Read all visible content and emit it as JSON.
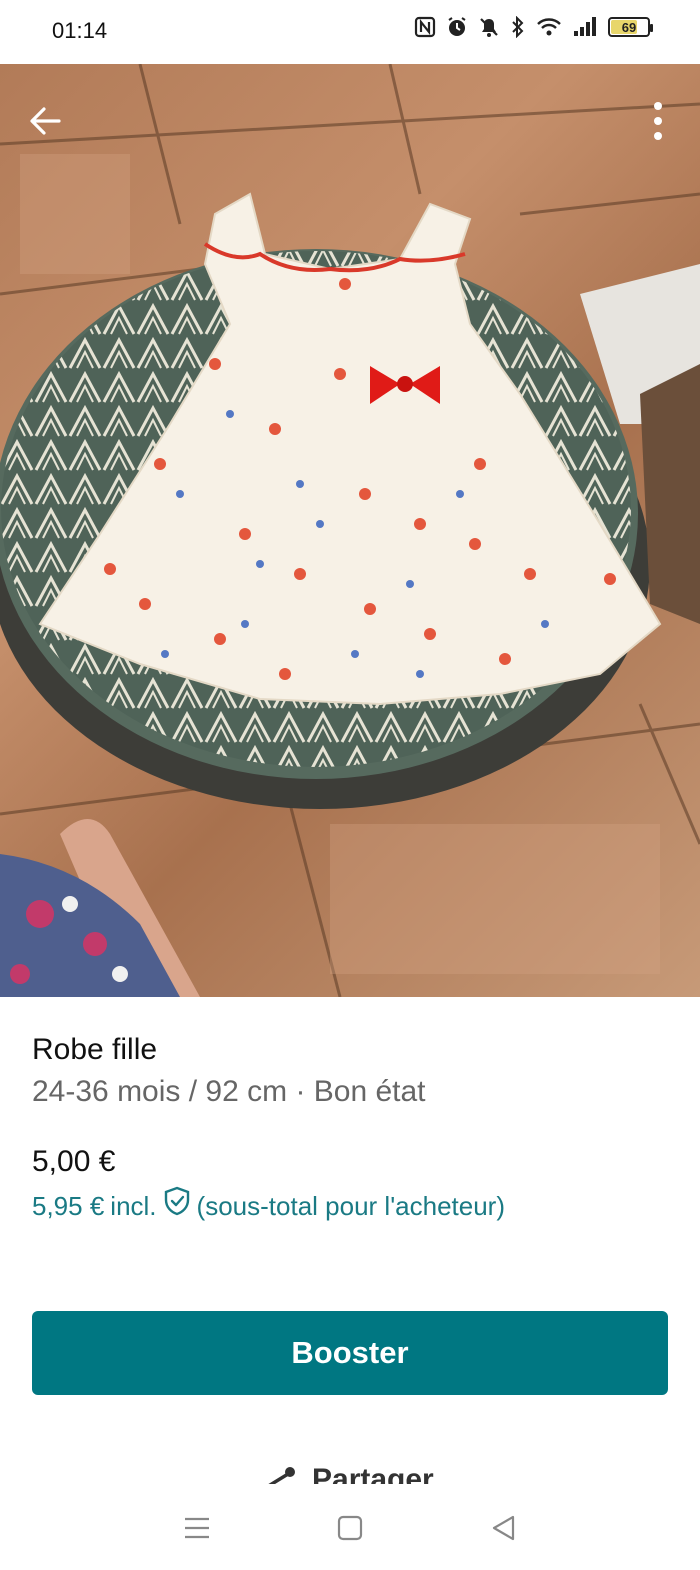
{
  "status_bar": {
    "time": "01:14",
    "battery_level": "69",
    "icons": [
      "nfc-icon",
      "alarm-icon",
      "mute-icon",
      "bluetooth-icon",
      "wifi-icon",
      "signal-icon",
      "battery-icon"
    ]
  },
  "photo": {
    "description_icon": "product-photo"
  },
  "item": {
    "title": "Robe fille",
    "subtitle": "24-36 mois / 92 cm · Bon état",
    "price": "5,00 €",
    "price_incl_amount": "5,95 €",
    "price_incl_label": "incl.",
    "price_incl_note": "(sous-total pour l'acheteur)"
  },
  "actions": {
    "booster_label": "Booster",
    "share_label": "Partager"
  },
  "colors": {
    "accent": "#007782",
    "accent_text": "#1a7a84"
  }
}
